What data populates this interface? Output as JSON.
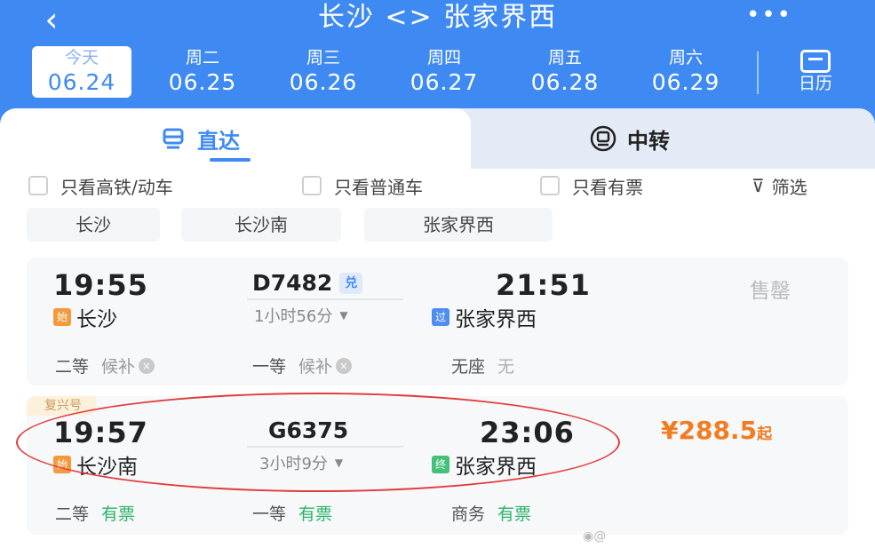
{
  "header": {
    "back_icon": "‹",
    "title": "长沙 <> 张家界西",
    "more_icon": "•••"
  },
  "dates": [
    {
      "weekday": "今天",
      "date": "06.24",
      "selected": true
    },
    {
      "weekday": "周二",
      "date": "06.25"
    },
    {
      "weekday": "周三",
      "date": "06.26"
    },
    {
      "weekday": "周四",
      "date": "06.27"
    },
    {
      "weekday": "周五",
      "date": "06.28"
    },
    {
      "weekday": "周六",
      "date": "06.29"
    }
  ],
  "calendar": {
    "label": "日历",
    "icon": "calendar-icon"
  },
  "tabs": {
    "direct": "直达",
    "transfer": "中转"
  },
  "filters": {
    "highspeed": "只看高铁/动车",
    "normal": "只看普通车",
    "available": "只看有票",
    "screen": "筛选"
  },
  "stations": [
    "长沙",
    "长沙南",
    "张家界西"
  ],
  "trains": [
    {
      "depart_time": "19:55",
      "depart_tag": "始",
      "depart_station": "长沙",
      "train_no": "D7482",
      "badge_dui": "兑",
      "duration": "1小时56分",
      "arrive_time": "21:51",
      "arrive_tag": "过",
      "arrive_station": "张家界西",
      "status": "售罄",
      "seats": [
        {
          "type": "二等",
          "availability": "候补"
        },
        {
          "type": "一等",
          "availability": "候补"
        },
        {
          "type": "无座",
          "availability": "无"
        }
      ]
    },
    {
      "badge": "复兴号",
      "depart_time": "19:57",
      "depart_tag": "始",
      "depart_station": "长沙南",
      "train_no": "G6375",
      "duration": "3小时9分",
      "arrive_time": "23:06",
      "arrive_tag": "终",
      "arrive_station": "张家界西",
      "price": "¥288.5",
      "price_suffix": "起",
      "seats": [
        {
          "type": "二等",
          "availability": "有票"
        },
        {
          "type": "一等",
          "availability": "有票"
        },
        {
          "type": "商务",
          "availability": "有票"
        }
      ]
    }
  ],
  "colors": {
    "brand": "#3f8af2",
    "price": "#f27c22",
    "available": "#2cb36a",
    "annotation": "#e23a3a"
  }
}
